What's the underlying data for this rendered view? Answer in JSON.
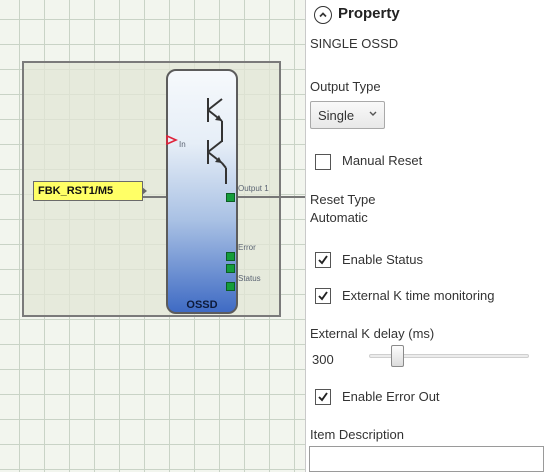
{
  "canvas": {
    "fbk_input_label": "FBK_RST1/M5",
    "ossd_block": {
      "title": "OSSD",
      "pin_in": "In",
      "pin_output": "Output 1",
      "pin_error": "Error",
      "pin_status": "Status"
    }
  },
  "property": {
    "header": "Property",
    "block_name": "SINGLE OSSD",
    "output_type_label": "Output Type",
    "output_type_value": "Single",
    "manual_reset_label": "Manual Reset",
    "manual_reset_checked": false,
    "reset_type_label": "Reset Type",
    "reset_type_value": "Automatic",
    "enable_status_label": "Enable Status",
    "enable_status_checked": true,
    "ext_k_time_label": "External K time monitoring",
    "ext_k_time_checked": true,
    "ext_k_delay_label": "External K delay (ms)",
    "ext_k_delay_value": "300",
    "enable_error_out_label": "Enable Error Out",
    "enable_error_out_checked": true,
    "item_description_label": "Item Description",
    "item_description_value": ""
  },
  "icons": [
    "collapse-up-icon",
    "chevron-down-icon",
    "checkmark-icon",
    "transistor-symbol-icon",
    "input-arrow-icon"
  ]
}
